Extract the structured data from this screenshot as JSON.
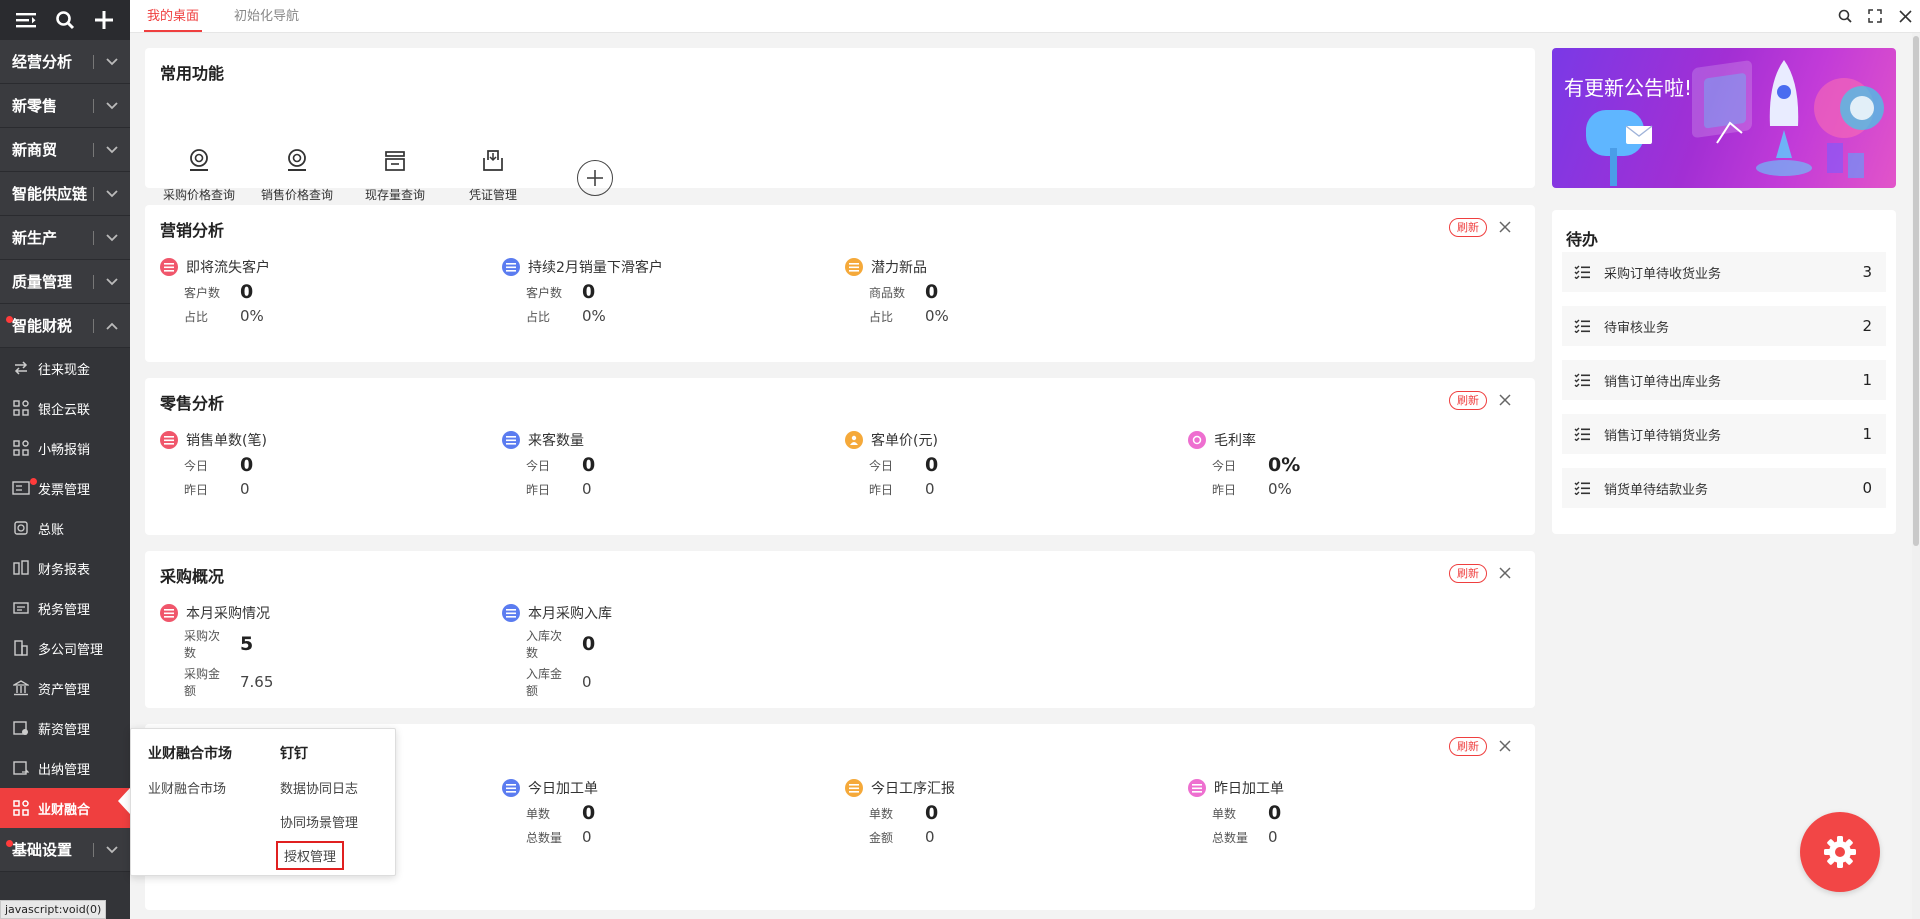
{
  "sidebar": {
    "sections_top": [
      {
        "label": "经营分析"
      },
      {
        "label": "新零售"
      },
      {
        "label": "新商贸"
      },
      {
        "label": "智能供应链"
      },
      {
        "label": "新生产"
      },
      {
        "label": "质量管理"
      },
      {
        "label": "智能财税"
      }
    ],
    "sub_items": [
      {
        "label": "往来现金",
        "icon": "swap-icon"
      },
      {
        "label": "银企云联",
        "icon": "apps-icon"
      },
      {
        "label": "小畅报销",
        "icon": "apps-icon"
      },
      {
        "label": "发票管理",
        "icon": "invoice-icon"
      },
      {
        "label": "总账",
        "icon": "ledger-icon"
      },
      {
        "label": "财务报表",
        "icon": "report-icon"
      },
      {
        "label": "税务管理",
        "icon": "tax-icon"
      },
      {
        "label": "多公司管理",
        "icon": "building-icon"
      },
      {
        "label": "资产管理",
        "icon": "bank-icon"
      },
      {
        "label": "薪资管理",
        "icon": "salary-icon"
      },
      {
        "label": "出纳管理",
        "icon": "cashier-icon"
      },
      {
        "label": "业财融合",
        "icon": "apps-icon"
      }
    ],
    "section_bottom": {
      "label": "基础设置"
    }
  },
  "tabs": [
    {
      "label": "我的桌面"
    },
    {
      "label": "初始化导航"
    }
  ],
  "common_functions": {
    "title": "常用功能",
    "items": [
      {
        "label": "采购价格查询",
        "icon": "price-query-icon"
      },
      {
        "label": "销售价格查询",
        "icon": "price-query-icon"
      },
      {
        "label": "现存量查询",
        "icon": "inventory-icon"
      },
      {
        "label": "凭证管理",
        "icon": "voucher-icon"
      }
    ]
  },
  "refresh_label": "刷新",
  "marketing": {
    "title": "营销分析",
    "metrics": [
      {
        "name": "即将流失客户",
        "color": "#f0566b",
        "r1k": "客户数",
        "r1v": "0",
        "r2k": "占比",
        "r2v": "0%"
      },
      {
        "name": "持续2月销量下滑客户",
        "color": "#5b7cf0",
        "r1k": "客户数",
        "r1v": "0",
        "r2k": "占比",
        "r2v": "0%"
      },
      {
        "name": "潜力新品",
        "color": "#f5a93a",
        "r1k": "商品数",
        "r1v": "0",
        "r2k": "占比",
        "r2v": "0%"
      }
    ]
  },
  "retail": {
    "title": "零售分析",
    "metrics": [
      {
        "name": "销售单数(笔)",
        "color": "#f0566b",
        "r1k": "今日",
        "r1v": "0",
        "r2k": "昨日",
        "r2v": "0"
      },
      {
        "name": "来客数量",
        "color": "#5b7cf0",
        "r1k": "今日",
        "r1v": "0",
        "r2k": "昨日",
        "r2v": "0"
      },
      {
        "name": "客单价(元)",
        "color": "#f5a93a",
        "r1k": "今日",
        "r1v": "0",
        "r2k": "昨日",
        "r2v": "0"
      },
      {
        "name": "毛利率",
        "color": "#ee6fd0",
        "r1k": "今日",
        "r1v": "0%",
        "r2k": "昨日",
        "r2v": "0%"
      }
    ]
  },
  "purchase": {
    "title": "采购概况",
    "metrics": [
      {
        "name": "本月采购情况",
        "color": "#f0566b",
        "r1k": "采购次数",
        "r1v": "5",
        "r2k": "采购金额",
        "r2v": "7.65"
      },
      {
        "name": "本月采购入库",
        "color": "#5b7cf0",
        "r1k": "入库次数",
        "r1v": "0",
        "r2k": "入库金额",
        "r2v": "0"
      }
    ]
  },
  "production": {
    "metrics": [
      {
        "name": "今日加工单",
        "color": "#5b7cf0",
        "r1k": "单数",
        "r1v": "0",
        "r2k": "总数量",
        "r2v": "0"
      },
      {
        "name": "今日工序汇报",
        "color": "#f5a93a",
        "r1k": "单数",
        "r1v": "0",
        "r2k": "金额",
        "r2v": "0"
      },
      {
        "name": "昨日加工单",
        "color": "#ee6fd0",
        "r1k": "单数",
        "r1v": "0",
        "r2k": "总数量",
        "r2v": "0"
      }
    ]
  },
  "banner": {
    "title": "有更新公告啦!"
  },
  "todo": {
    "title": "待办",
    "items": [
      {
        "label": "采购订单待收货业务",
        "count": "3"
      },
      {
        "label": "待审核业务",
        "count": "2"
      },
      {
        "label": "销售订单待出库业务",
        "count": "1"
      },
      {
        "label": "销售订单待销货业务",
        "count": "1"
      },
      {
        "label": "销货单待结款业务",
        "count": "0"
      }
    ]
  },
  "popup": {
    "col1": {
      "heading": "业财融合市场",
      "items": [
        "业财融合市场"
      ]
    },
    "col2": {
      "heading": "钉钉",
      "items": [
        "数据协同日志",
        "协同场景管理",
        "授权管理"
      ]
    }
  },
  "statusbar": {
    "text": "javascript:void(0)"
  }
}
